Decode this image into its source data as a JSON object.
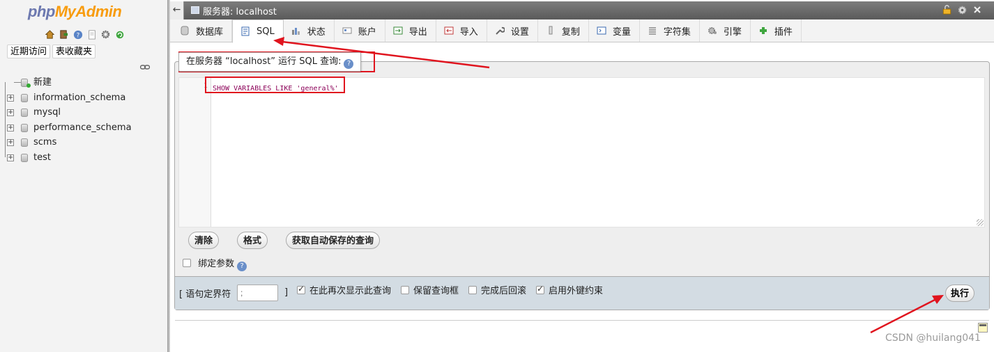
{
  "nav": {
    "logo_php": "php",
    "logo_myadmin": "MyAdmin",
    "icon_names": [
      "home-icon",
      "exit-icon",
      "help-icon",
      "docs-icon",
      "settings-icon",
      "reload-icon"
    ],
    "btn_recent": "近期访问",
    "btn_favorites": "表收藏夹",
    "tree": [
      {
        "label": "新建",
        "type": "new"
      },
      {
        "label": "information_schema",
        "type": "db"
      },
      {
        "label": "mysql",
        "type": "db"
      },
      {
        "label": "performance_schema",
        "type": "db"
      },
      {
        "label": "scms",
        "type": "db"
      },
      {
        "label": "test",
        "type": "db"
      }
    ]
  },
  "topbar": {
    "back_label": "←",
    "server_label": "服务器: localhost",
    "icon_names": [
      "lock-icon",
      "gear-icon",
      "close-icon"
    ]
  },
  "tabs": [
    {
      "label": "数据库",
      "icon": "database-icon",
      "active": false
    },
    {
      "label": "SQL",
      "icon": "sql-icon",
      "active": true
    },
    {
      "label": "状态",
      "icon": "status-icon",
      "active": false
    },
    {
      "label": "账户",
      "icon": "accounts-icon",
      "active": false
    },
    {
      "label": "导出",
      "icon": "export-icon",
      "active": false
    },
    {
      "label": "导入",
      "icon": "import-icon",
      "active": false
    },
    {
      "label": "设置",
      "icon": "wrench-icon",
      "active": false
    },
    {
      "label": "复制",
      "icon": "replication-icon",
      "active": false
    },
    {
      "label": "变量",
      "icon": "variables-icon",
      "active": false
    },
    {
      "label": "字符集",
      "icon": "charset-icon",
      "active": false
    },
    {
      "label": "引擎",
      "icon": "engine-icon",
      "active": false
    },
    {
      "label": "插件",
      "icon": "plugin-icon",
      "active": false
    }
  ],
  "sql_panel": {
    "legend": "在服务器 “localhost” 运行 SQL 查询:",
    "line_number": "1",
    "query": "SHOW VARIABLES LIKE 'general%'",
    "btn_clear": "清除",
    "btn_format": "格式",
    "btn_autosave": "获取自动保存的查询",
    "bind_params": "绑定参数",
    "bind_params_checked": false
  },
  "bottom": {
    "delimiter_label": "[ 语句定界符",
    "delimiter_value": ";",
    "delimiter_close": "]",
    "opt_show_again": "在此再次显示此查询",
    "opt_show_again_checked": true,
    "opt_keep_box": "保留查询框",
    "opt_keep_box_checked": false,
    "opt_rollback": "完成后回滚",
    "opt_rollback_checked": false,
    "opt_fk": "启用外键约束",
    "opt_fk_checked": true,
    "btn_go": "执行"
  },
  "watermark": "CSDN @huilang041",
  "colors": {
    "annotation_red": "#e0141e",
    "logo_blue": "#6c78af",
    "logo_orange": "#f89c0e",
    "query_text": "#8b0058"
  }
}
